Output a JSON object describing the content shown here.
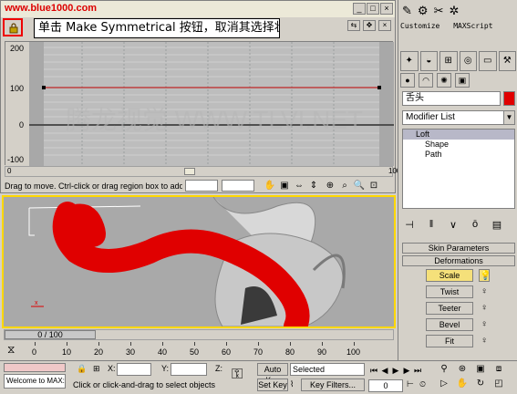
{
  "watermark": "www.blue1000.com",
  "callout_text": "单击 Make Symmetrical 按钮，取消其选择状态。",
  "graph": {
    "y_labels": [
      "200",
      "100",
      "0",
      "-100"
    ],
    "x_start": "0",
    "x_end": "100",
    "curve_value": 100
  },
  "status_message": "Drag to move. Ctrl-click or drag region box to add to s",
  "panel": {
    "top_labels": [
      "Customize",
      "MAXScript"
    ],
    "object_name": "舌头",
    "modifier_list": "Modifier List",
    "stack": [
      {
        "label": "Loft",
        "selected": true,
        "sub": false
      },
      {
        "label": "Shape",
        "selected": false,
        "sub": true
      },
      {
        "label": "Path",
        "selected": false,
        "sub": true
      }
    ],
    "rollouts": {
      "skin": "Skin Parameters",
      "deformations": "Deformations"
    },
    "deform_buttons": [
      "Scale",
      "Twist",
      "Teeter",
      "Bevel",
      "Fit"
    ]
  },
  "timeline": {
    "slider": "0 / 100",
    "ticks": [
      "0",
      "10",
      "20",
      "30",
      "40",
      "50",
      "60",
      "70",
      "80",
      "90",
      "100"
    ]
  },
  "bottom": {
    "maxscript_text": "Welcome to MAX:",
    "status": "Click or click-and-drag to select objects",
    "x_label": "X:",
    "y_label": "Y:",
    "z_label": "Z:",
    "auto_key": "Auto Key",
    "set_key": "Set Key",
    "selected": "Selected",
    "key_filters": "Key Filters...",
    "frame": "0"
  },
  "colors": {
    "accent_red": "#e00000",
    "viewport_border": "#ffd800",
    "active_button": "#f5e07a"
  }
}
